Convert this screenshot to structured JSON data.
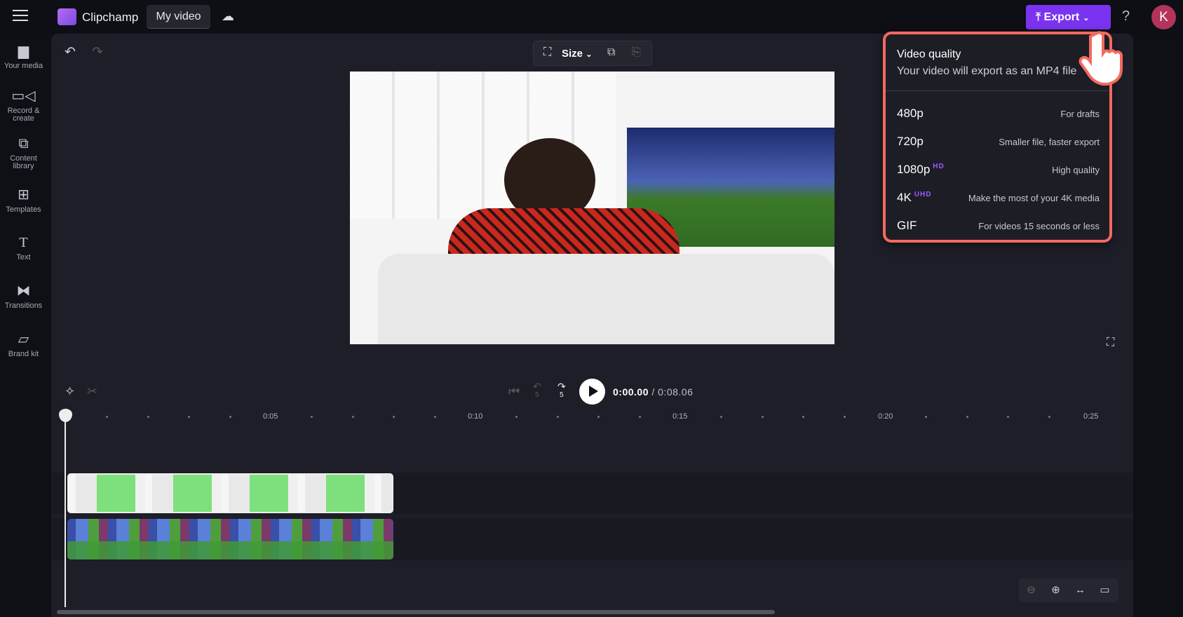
{
  "header": {
    "app_name": "Clipchamp",
    "project_name": "My video",
    "export_label": "Export",
    "help_label": "?",
    "avatar_initial": "K",
    "accent": "#7a33f0"
  },
  "sidebar": {
    "items": [
      {
        "label": "Your media",
        "icon": "folder-icon"
      },
      {
        "label": "Record &\ncreate",
        "icon": "camera-icon"
      },
      {
        "label": "Content\nlibrary",
        "icon": "content-library-icon"
      },
      {
        "label": "Templates",
        "icon": "templates-icon"
      },
      {
        "label": "Text",
        "icon": "text-icon"
      },
      {
        "label": "Transitions",
        "icon": "transitions-icon"
      },
      {
        "label": "Brand kit",
        "icon": "brand-kit-icon"
      }
    ]
  },
  "toolbar": {
    "size_label": "Size"
  },
  "export_menu": {
    "title": "Video quality",
    "subtitle": "Your video will export as an MP4 file",
    "highlight_color": "#f26a5e",
    "options": [
      {
        "quality": "480p",
        "badge": "",
        "description": "For drafts"
      },
      {
        "quality": "720p",
        "badge": "",
        "description": "Smaller file, faster export"
      },
      {
        "quality": "1080p",
        "badge": "HD",
        "description": "High quality"
      },
      {
        "quality": "4K",
        "badge": "UHD",
        "description": "Make the most of your 4K media"
      },
      {
        "quality": "GIF",
        "badge": "",
        "description": "For videos 15 seconds or less"
      }
    ]
  },
  "playback": {
    "current_time": "0:00.00",
    "total_time": "/ 0:08.06",
    "skip_back_label": "5",
    "skip_fwd_label": "5"
  },
  "timeline": {
    "ticks": [
      "0:05",
      "0:10",
      "0:15",
      "0:20",
      "0:25"
    ]
  }
}
